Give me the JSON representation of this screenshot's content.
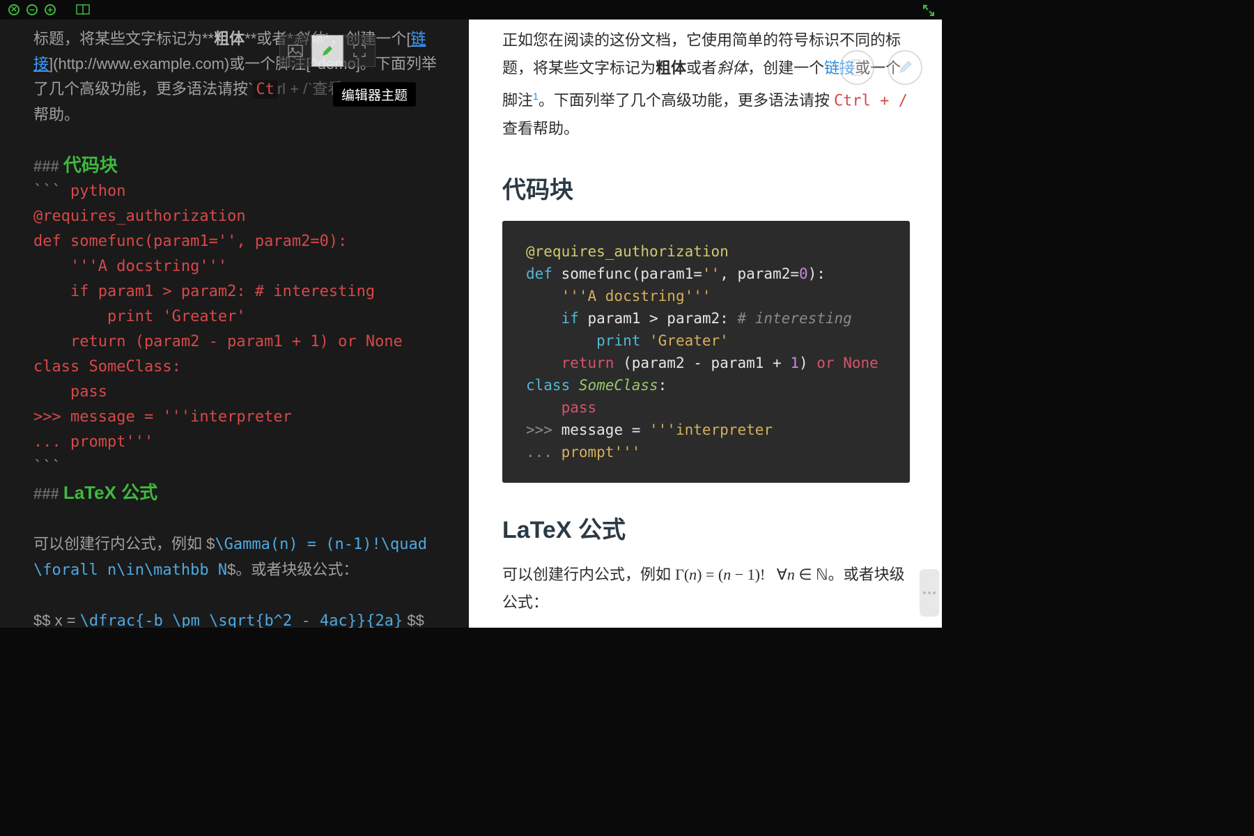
{
  "titlebar": {
    "close_name": "close",
    "minimize_name": "minimize",
    "maximize_name": "maximize",
    "book_name": "notebook",
    "fullscreen_name": "fullscreen"
  },
  "toolbar": {
    "image_name": "image",
    "brush_name": "editor-theme",
    "expand_name": "expand",
    "tooltip": "编辑器主题"
  },
  "editor": {
    "intro_pre": "标题，将某些文字标记为**",
    "bold": "粗体",
    "intro_mid": "**或者*",
    "italic": "斜体",
    "intro_post": "*，创建一个[",
    "link_text": "链接",
    "link_url_open": "](",
    "link_url": "http://www.example.com",
    "link_url_close": ")或一个脚注[^demo]。下面列举了几个高级功能，更多语法请按`",
    "ctrl_part": "Ct",
    "intro_tail": "帮助。",
    "h3_code_title": "代码块",
    "fence_open": "```",
    "code_lang": " python",
    "code_l1": "@requires_authorization",
    "code_l2": "def somefunc(param1='', param2=0):",
    "code_l3": "    '''A docstring'''",
    "code_l4": "    if param1 > param2: # interesting",
    "code_l5": "        print 'Greater'",
    "code_l6": "    return (param2 - param1 + 1) or None",
    "code_l7": "class SomeClass:",
    "code_l8": "    pass",
    "code_l9": ">>> message = '''interpreter",
    "code_l10": "... prompt'''",
    "fence_close": "```",
    "h3_latex_title": "LaTeX 公式",
    "latex_inline_pre": "可以创建行内公式，例如 $",
    "latex_inline_body1": "\\Gamma(n) = (n-1)!",
    "latex_inline_body2": "\\quad\\forall n\\in\\mathbb N",
    "latex_inline_post": "$。或者块级公式：",
    "latex_block_pre": "$$   x = ",
    "latex_block_body": "\\dfrac{-b \\pm \\sqrt{b^2 - 4ac}}{2a}",
    "latex_block_post": " $$"
  },
  "preview": {
    "intro_pre": "正如您在阅读的这份文档，它使用简单的符号标识不同的标题，将某些文字标记为",
    "bold": "粗体",
    "intro_mid": "或者",
    "italic": "斜体",
    "intro_post": "，创建一个",
    "link_text": "链接",
    "intro_after_link": "或一个脚注",
    "footnote_num": "1",
    "intro_tail1": "。下面列举了几个高级功能，更多语法请按 ",
    "ctrl_key": "Ctrl + /",
    "intro_tail2": " 查看帮助。",
    "h3_code": "代码块",
    "h3_latex": "LaTeX 公式",
    "latex_inline_pre": "可以创建行内公式，例如 ",
    "latex_inline_post": "。或者块级公式：",
    "float_pg_name": "page-link",
    "float_pen_name": "edit"
  },
  "syntax_tokens": {
    "decorator": "@requires_authorization",
    "def": "def",
    "funcname": " somefunc",
    "params": "(param1=",
    "emptystr": "''",
    "paramsep": ", param2=",
    "zero": "0",
    "paren_colon": "):",
    "docstring": "    '''A docstring'''",
    "if": "    if",
    "cond": " param1 > param2: ",
    "comment": "# interesting",
    "indent_print": "        ",
    "print": "print",
    "printarg": " 'Greater'",
    "return": "    return",
    "retexpr_open": " (param2 - param1 + ",
    "one": "1",
    "retexpr_close": ") ",
    "or": "or",
    "space": " ",
    "none": "None",
    "class": "class",
    "classname": " SomeClass",
    "colon": ":",
    "pass_indent": "    ",
    "pass": "pass",
    "prompt1": ">>>",
    "msg_assign": " message = ",
    "interpstr1": "'''interpreter",
    "prompt2": "...",
    "interpstr2": " prompt'''"
  }
}
